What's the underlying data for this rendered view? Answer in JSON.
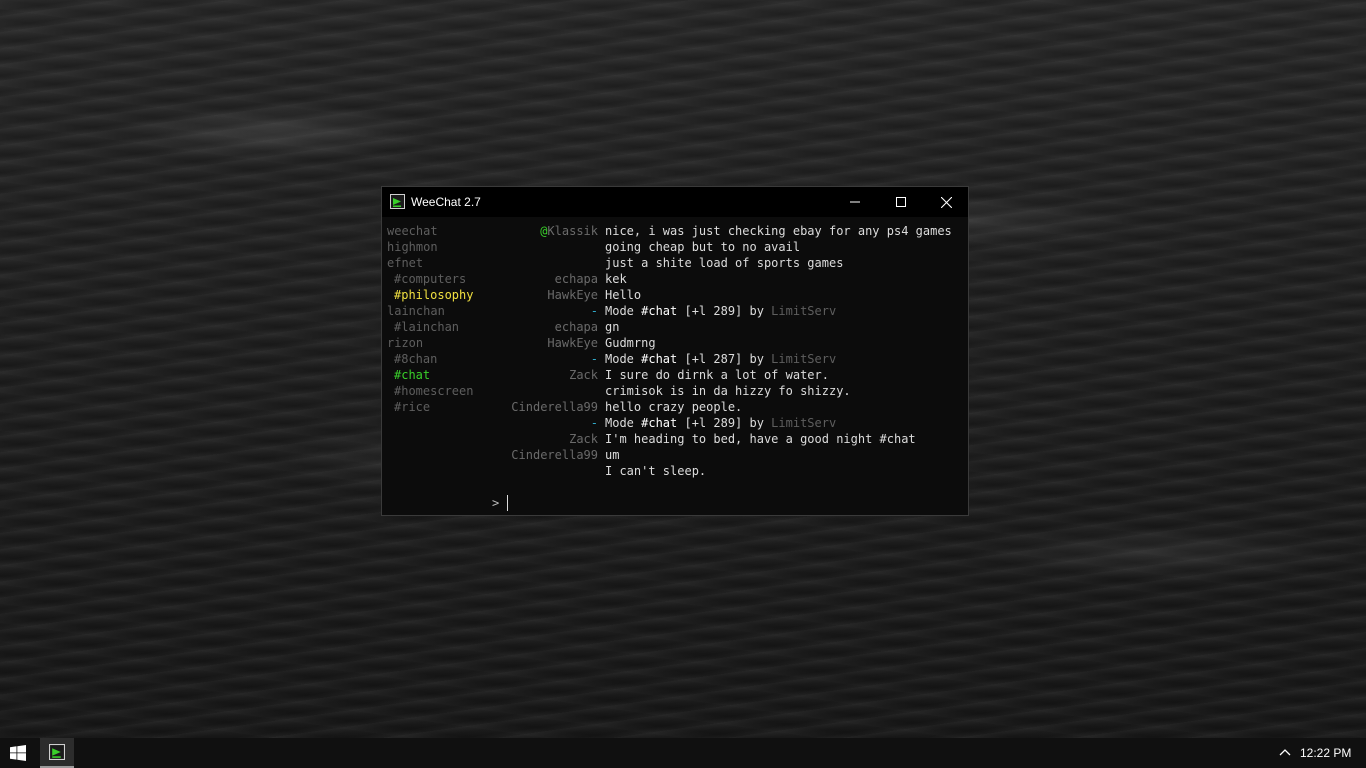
{
  "window": {
    "title": "WeeChat 2.7"
  },
  "buffers": [
    {
      "label": "weechat",
      "indent": false,
      "state": "normal"
    },
    {
      "label": "highmon",
      "indent": false,
      "state": "normal"
    },
    {
      "label": "efnet",
      "indent": false,
      "state": "normal"
    },
    {
      "label": "#computers",
      "indent": true,
      "state": "normal"
    },
    {
      "label": "#philosophy",
      "indent": true,
      "state": "active"
    },
    {
      "label": "lainchan",
      "indent": false,
      "state": "normal"
    },
    {
      "label": "#lainchan",
      "indent": true,
      "state": "normal"
    },
    {
      "label": "rizon",
      "indent": false,
      "state": "normal"
    },
    {
      "label": "#8chan",
      "indent": true,
      "state": "normal"
    },
    {
      "label": "#chat",
      "indent": true,
      "state": "current"
    },
    {
      "label": "#homescreen",
      "indent": true,
      "state": "normal"
    },
    {
      "label": "#rice",
      "indent": true,
      "state": "normal"
    }
  ],
  "chat": [
    {
      "prefix": "@",
      "nick": "Klassik",
      "text": "nice, i was just checking ebay for any ps4 games"
    },
    {
      "nick": "",
      "text": "going cheap but to no avail"
    },
    {
      "nick": "",
      "text": "just a shite load of sports games"
    },
    {
      "nick": "echapa",
      "text": "kek"
    },
    {
      "nick": "HawkEye",
      "text": "Hello"
    },
    {
      "nick": "-",
      "mode": true,
      "before": "Mode ",
      "chan": "#chat",
      "mid": " [+l 289] by ",
      "by": "LimitServ"
    },
    {
      "nick": "echapa",
      "text": "gn"
    },
    {
      "nick": "HawkEye",
      "text": "Gudmrng"
    },
    {
      "nick": "-",
      "mode": true,
      "before": "Mode ",
      "chan": "#chat",
      "mid": " [+l 287] by ",
      "by": "LimitServ"
    },
    {
      "nick": "Zack",
      "text": "I sure do dirnk a lot of water."
    },
    {
      "nick": "",
      "text": "crimisok is in da hizzy fo shizzy."
    },
    {
      "nick": "Cinderella99",
      "text": "hello crazy people."
    },
    {
      "nick": "-",
      "mode": true,
      "before": "Mode ",
      "chan": "#chat",
      "mid": " [+l 289] by ",
      "by": "LimitServ"
    },
    {
      "nick": "Zack",
      "text": "I'm heading to bed, have a good night #chat"
    },
    {
      "nick": "Cinderella99",
      "text": "um"
    },
    {
      "nick": "",
      "text": "I can't sleep."
    }
  ],
  "input": {
    "prompt": ">"
  },
  "taskbar": {
    "clock": "12:22 PM"
  },
  "colors": {
    "current_buffer": "#39d02a",
    "active_buffer": "#f0e040",
    "nick_gray": "#6a6a6a",
    "mode_dash": "#2fa8c8"
  }
}
